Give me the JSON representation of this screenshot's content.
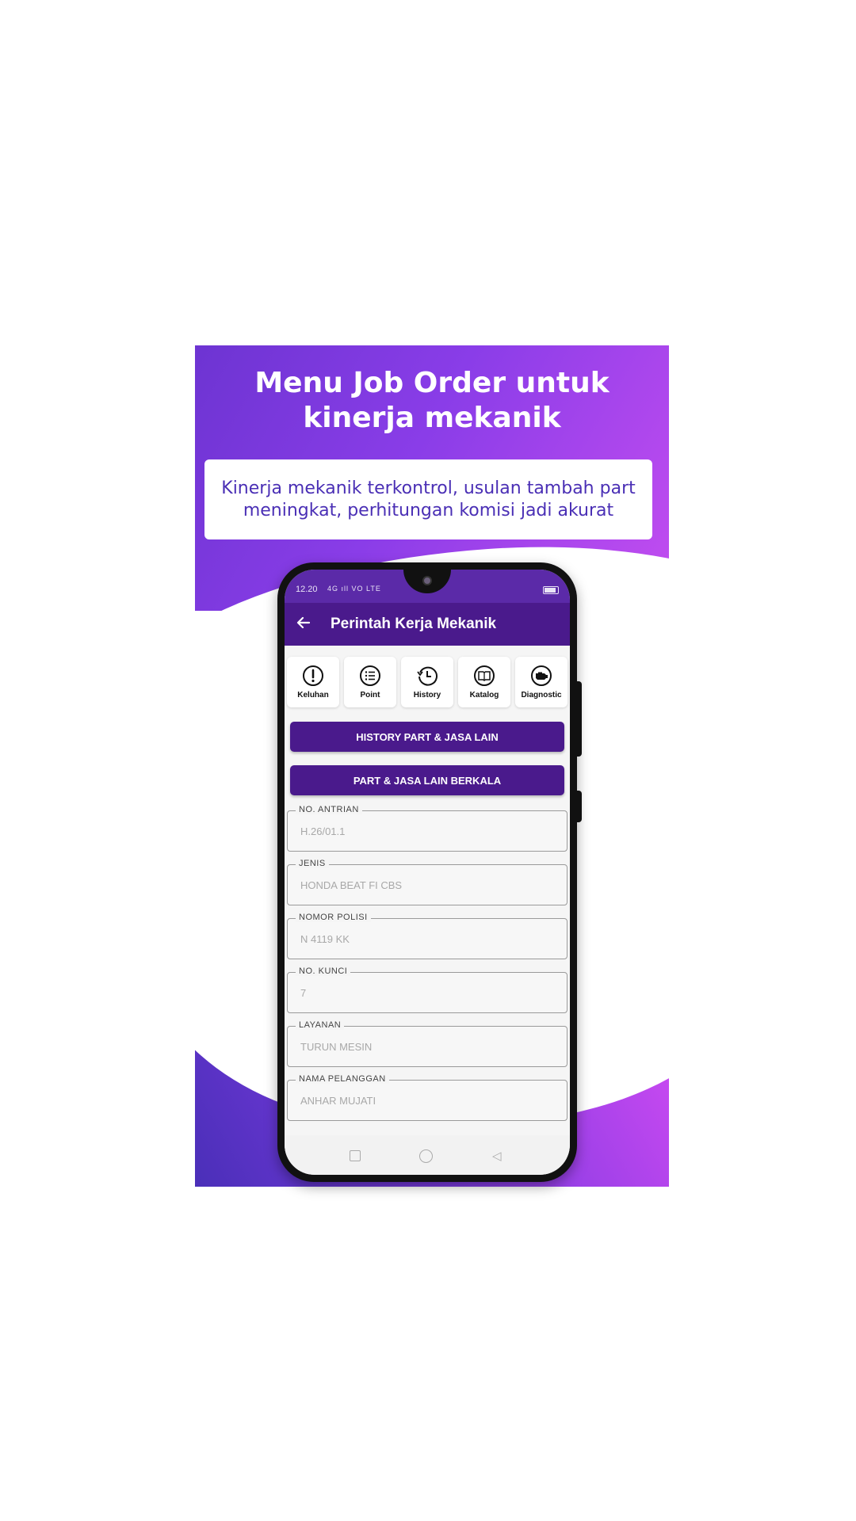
{
  "banner": {
    "headline_line1": "Menu Job Order untuk",
    "headline_line2": "kinerja mekanik",
    "subtitle": "Kinerja mekanik terkontrol, usulan tambah part meningkat, perhitungan komisi jadi akurat"
  },
  "statusbar": {
    "time": "12.20",
    "signal": "4G ıll VO LTE"
  },
  "appbar": {
    "back_icon": "arrow-left-icon",
    "title": "Perintah Kerja Mekanik"
  },
  "menu": [
    {
      "label": "Keluhan",
      "icon": "exclamation-circle-icon"
    },
    {
      "label": "Point",
      "icon": "checklist-icon"
    },
    {
      "label": "History",
      "icon": "history-clock-icon"
    },
    {
      "label": "Katalog",
      "icon": "book-icon"
    },
    {
      "label": "Diagnostic",
      "icon": "engine-icon"
    }
  ],
  "buttons": {
    "history": "HISTORY PART & JASA LAIN",
    "berkala": "PART & JASA LAIN BERKALA"
  },
  "fields": [
    {
      "label": "NO. ANTRIAN",
      "value": "H.26/01.1"
    },
    {
      "label": "JENIS",
      "value": "HONDA BEAT FI CBS"
    },
    {
      "label": "NOMOR POLISI",
      "value": "N 4119 KK"
    },
    {
      "label": "NO. KUNCI",
      "value": "7"
    },
    {
      "label": "LAYANAN",
      "value": "TURUN MESIN"
    },
    {
      "label": "NAMA PELANGGAN",
      "value": "ANHAR MUJATI"
    }
  ],
  "colors": {
    "primary": "#4a1a8c",
    "gradient_start": "#6d34d2",
    "gradient_end": "#c34df0",
    "subtitle": "#4a2fb5"
  }
}
